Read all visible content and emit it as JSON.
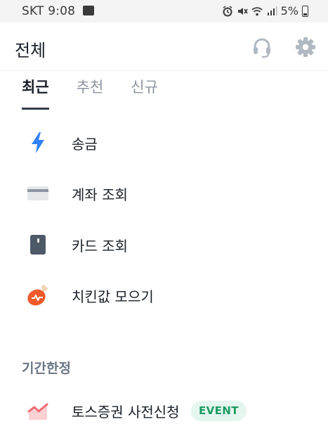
{
  "status_bar": {
    "carrier": "SKT",
    "time": "9:08",
    "battery": "5%",
    "icons": [
      "gallery-icon",
      "alarm-icon",
      "mute-icon",
      "wifi-icon",
      "signal-icon",
      "battery-icon"
    ]
  },
  "header": {
    "title": "전체",
    "support_icon": "headset-icon",
    "settings_icon": "gear-icon"
  },
  "tabs": [
    {
      "label": "최근",
      "active": true
    },
    {
      "label": "추천",
      "active": false
    },
    {
      "label": "신규",
      "active": false
    }
  ],
  "menu": [
    {
      "label": "송금",
      "icon": "lightning-icon",
      "color": "#3182f6"
    },
    {
      "label": "계좌 조회",
      "icon": "account-card-icon",
      "color": "#d9dde3"
    },
    {
      "label": "카드 조회",
      "icon": "card-icon",
      "color": "#4e5968"
    },
    {
      "label": "치킨값 모으기",
      "icon": "chicken-icon",
      "color": "#f05a2b"
    }
  ],
  "limited_section": {
    "title": "기간한정",
    "items": [
      {
        "label": "토스증권 사전신청",
        "icon": "stock-chart-icon",
        "badge": "EVENT",
        "color": "#f36b72"
      }
    ]
  },
  "colors": {
    "accent_blue": "#3182f6",
    "badge_green": "#1b9c63",
    "badge_bg": "#e5f6ee"
  }
}
